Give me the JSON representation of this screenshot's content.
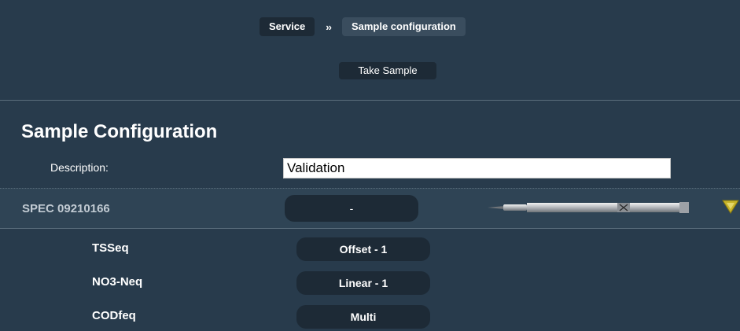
{
  "breadcrumb": {
    "items": [
      "Service",
      "Sample configuration"
    ],
    "separator": "››"
  },
  "toolbar": {
    "take_sample_label": "Take Sample"
  },
  "main": {
    "title": "Sample Configuration",
    "description": {
      "label": "Description:",
      "value": "Validation"
    },
    "spec": {
      "label": "SPEC 09210166",
      "selected": "-",
      "probe_icon": "sensor-probe-icon",
      "expand_icon": "triangle-down-icon"
    },
    "parameters": [
      {
        "name": "TSSeq",
        "value": "Offset - 1"
      },
      {
        "name": "NO3-Neq",
        "value": "Linear - 1"
      },
      {
        "name": "CODfeq",
        "value": "Multi"
      }
    ]
  },
  "colors": {
    "background": "#283b4c",
    "button": "#1d2a36",
    "spec_row": "#2f4455",
    "accent_arrow": "#c8b42a"
  }
}
